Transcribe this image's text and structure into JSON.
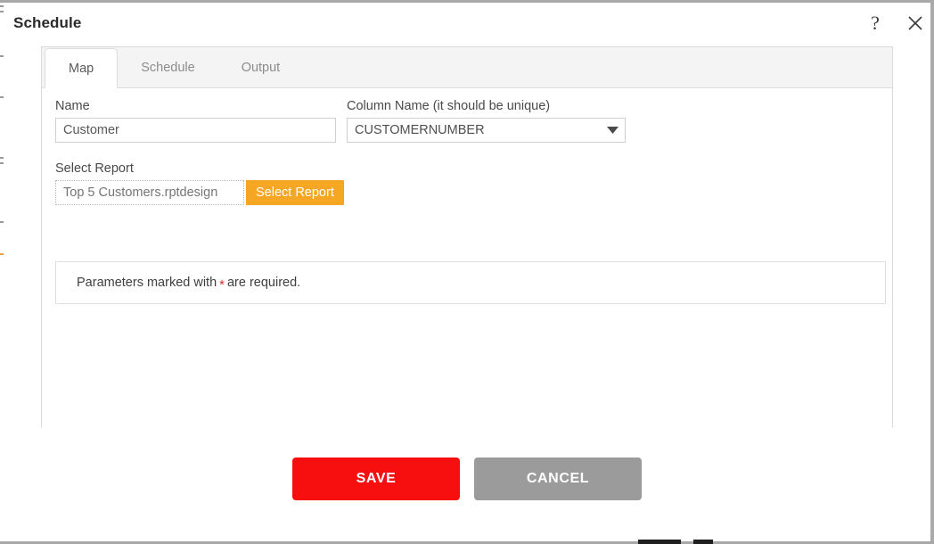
{
  "window": {
    "title": "Schedule",
    "help_icon": "question-mark-icon",
    "close_icon": "close-x-icon"
  },
  "tabs": [
    {
      "label": "Map",
      "active": true
    },
    {
      "label": "Schedule",
      "active": false
    },
    {
      "label": "Output",
      "active": false
    }
  ],
  "form": {
    "name": {
      "label": "Name",
      "value": "Customer",
      "placeholder": "Name"
    },
    "column_name": {
      "label": "Column Name (it should be unique)",
      "value": "CUSTOMERNUMBER",
      "arrow_icon": "chevron-down-icon"
    },
    "select_report": {
      "label": "Select Report",
      "value": "Top 5 Customers.rptdesign",
      "placeholder": "Top 5 Customers.rptdesign",
      "button_label": "Select Report",
      "button_color": "#f5a623"
    },
    "params_notice": {
      "prefix": "Parameters marked with",
      "star": "*",
      "suffix": "are required.",
      "star_color": "#e8282b"
    }
  },
  "footer": {
    "save_label": "SAVE",
    "cancel_label": "CANCEL",
    "save_color": "#f70f0f",
    "cancel_color": "#9b9b9b"
  }
}
